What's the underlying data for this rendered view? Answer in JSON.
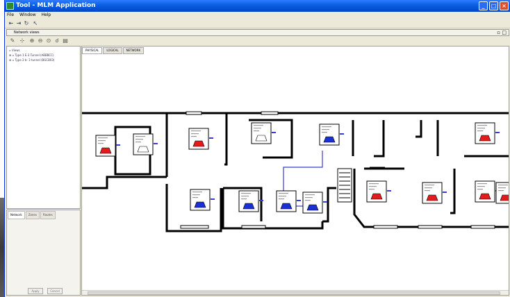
{
  "window": {
    "title": "Tool - MLM Application"
  },
  "menu": {
    "items": [
      "File",
      "Window",
      "Help"
    ]
  },
  "panel": {
    "title": "Network views"
  },
  "tree": {
    "items": [
      {
        "label": "Views"
      },
      {
        "label": "Type 1 E-3 Tunnel (ABBBCC)"
      },
      {
        "label": "Type 2 b- 3 tunnel (BGCB03)"
      }
    ]
  },
  "lower_tabs": [
    "Network",
    "Zones",
    "Routes"
  ],
  "lower_buttons": {
    "ok": "Apply",
    "cancel": "Cancel"
  },
  "view_tabs": [
    "PHYSICAL",
    "LOGICAL",
    "NETWORK"
  ],
  "colors": {
    "title_bar": "#0a5fe0",
    "node_red": "#e21c1c",
    "node_blue": "#1a2fd6",
    "node_white": "#ffffff",
    "link": "#3a3ad0"
  },
  "nodes": [
    {
      "id": "n1",
      "color": "red"
    },
    {
      "id": "n2",
      "color": "white"
    },
    {
      "id": "n3",
      "color": "red"
    },
    {
      "id": "n4",
      "color": "white"
    },
    {
      "id": "n5",
      "color": "blue"
    },
    {
      "id": "n6",
      "color": "red"
    },
    {
      "id": "n7",
      "color": "blue"
    },
    {
      "id": "n8",
      "color": "blue"
    },
    {
      "id": "n9",
      "color": "blue"
    },
    {
      "id": "n10",
      "color": "blue"
    },
    {
      "id": "n11",
      "color": "red"
    },
    {
      "id": "n12",
      "color": "red"
    },
    {
      "id": "n13",
      "color": "red"
    },
    {
      "id": "n14",
      "color": "red"
    }
  ]
}
